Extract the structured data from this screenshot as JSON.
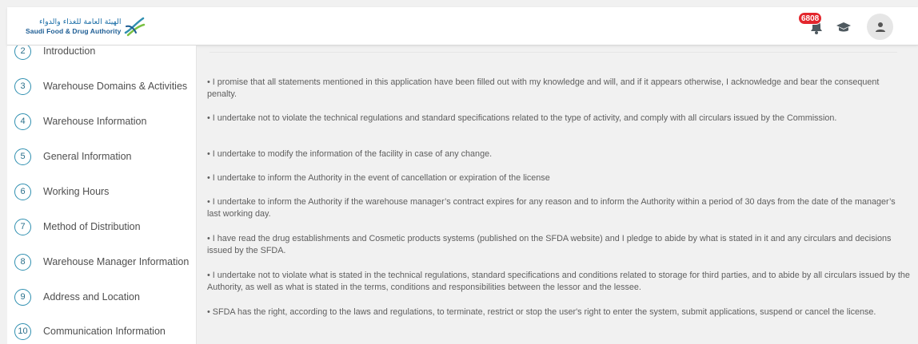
{
  "header": {
    "logo_ar": "الهيئة العامة للغذاء والدواء",
    "logo_en": "Saudi Food & Drug Authority",
    "notification_count": "6808",
    "brand_color": "#2a6f8a"
  },
  "sidebar": {
    "steps": [
      {
        "num": "2",
        "label": "Introduction"
      },
      {
        "num": "3",
        "label": "Warehouse Domains & Activities"
      },
      {
        "num": "4",
        "label": "Warehouse Information"
      },
      {
        "num": "5",
        "label": "General Information"
      },
      {
        "num": "6",
        "label": "Working Hours"
      },
      {
        "num": "7",
        "label": "Method of Distribution"
      },
      {
        "num": "8",
        "label": "Warehouse Manager Information"
      },
      {
        "num": "9",
        "label": "Address and Location"
      },
      {
        "num": "10",
        "label": "Communication Information"
      }
    ]
  },
  "statements": [
    "• I promise that all statements mentioned in this application have been filled out with my knowledge and will, and if it appears otherwise, I acknowledge and bear the consequent penalty.",
    "• I undertake not to violate the technical regulations and standard specifications related to the type of activity, and comply with all circulars issued by the Commission.",
    "• I undertake to modify the information of the facility in case of any change.",
    "• I undertake to inform the Authority in the event of cancellation or expiration of the license",
    "• I undertake to inform the Authority if the warehouse manager’s contract expires for any reason and to inform the Authority within a period of 30 days from the date of the manager’s last working day.",
    "• I have read the drug establishments and Cosmetic products systems (published on the SFDA website) and I pledge to abide by what is stated in it and any circulars and decisions issued by the SFDA.",
    "• I undertake not to violate what is stated in the technical regulations, standard specifications and conditions related to storage for third parties, and to abide by all circulars issued by the Authority, as well as what is stated in the terms, conditions and responsibilities between the lessor and the lessee.",
    "• SFDA has the right, according to the laws and regulations, to terminate, restrict or stop the user's right to enter the system, submit applications, suspend or cancel the license."
  ]
}
